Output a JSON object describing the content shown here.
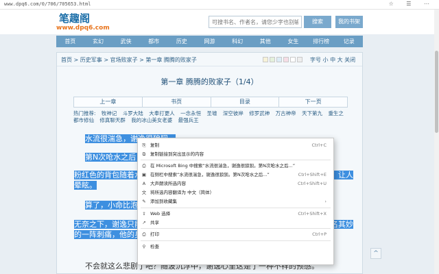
{
  "browser": {
    "url": "www.dpq6.com/0/706/705653.html",
    "actions": "☆ ☰ ⋯"
  },
  "site": {
    "logo_text": "笔趣阁",
    "domain": "www.dpq6.com",
    "search_placeholder": "可搜书名、作者名，请您少字也别输错字",
    "search_button": "搜索",
    "bookshelf_button": "我的书架"
  },
  "nav": [
    "首页",
    "玄幻",
    "武侠",
    "都市",
    "历史",
    "网游",
    "科幻",
    "其他",
    "女生",
    "排行榜",
    "记录"
  ],
  "breadcrumb": {
    "text": "首页 > 历史军事 > 官场败家子 > 第一章 腾腾的败家子",
    "swatch_colors": [
      "#f7f2d8",
      "#e4f1dc",
      "#dcecf6",
      "#f6dde6",
      "#ffffff",
      "#eeeeee"
    ],
    "font_controls": "字号 小 中 大 关闭"
  },
  "chapter": {
    "title": "第一章 腾腾的败家子（1/4）",
    "nav": [
      "上一章",
      "书页",
      "目录",
      "下一页"
    ]
  },
  "ads": [
    "热门推荐:",
    "牧神记",
    "斗罗大陆",
    "大奉打更人",
    "一念永恒",
    "圣墟",
    "深空彼岸",
    "修罗武神",
    "万古神帝",
    "天下第九",
    "重生之都市修仙",
    "修真聊天群",
    "我的冰山美女老婆",
    "最强兵王"
  ],
  "paragraphs": [
    {
      "text": "水流很湍急，谢逸很狼狈。"
    },
    {
      "text": "第N次呛水之后，他终于意识到"
    },
    {
      "text": "粉红色的背包随着水流飘走，让他知道自己没了活路，湍急的水再次灌入口鼻，让人晕眩。"
    },
    {
      "text": "算了，小命比泡妞要紧，"
    },
    {
      "text": "无奈之下，谢逸只能看着她离开，却想不出一个好的办法，关键时刻，脑袋莫名其妙的一阵刺痛，他的身体像是被人控制了一般，整个人便有些懵圈了。"
    },
    {
      "text": "不会就这么悲剧了吧？随波沉浮中，谢逸心里这是了一种不祥的预感。"
    }
  ],
  "context_menu": {
    "items": [
      {
        "icon": "⎘",
        "label": "复制",
        "shortcut": "Ctrl+C"
      },
      {
        "icon": "⧉",
        "label": "复制链接到突出显示的内容",
        "shortcut": ""
      },
      {
        "icon": "⎙",
        "label": "在 Microsoft Bing 中搜索“水流很湍急，谢逸很狼狈。第N次呛水之后...”",
        "shortcut": ""
      },
      {
        "icon": "▣",
        "label": "在侧栏中搜索“水流很湍急，谢逸很狼狈。第N次呛水之后...”",
        "shortcut": "Ctrl+Shift+E"
      },
      {
        "icon": "A",
        "label": "大声朗读所选内容",
        "shortcut": "Ctrl+Shift+U"
      },
      {
        "icon": "文",
        "label": "将所选内容翻译为 中文（简体）",
        "shortcut": ""
      },
      {
        "icon": "✎",
        "label": "添加到收藏集",
        "shortcut": ""
      },
      {
        "icon": "⇪",
        "label": "Web 选择",
        "shortcut": "Ctrl+Shift+X"
      },
      {
        "icon": "↗",
        "label": "共享",
        "shortcut": ""
      },
      {
        "icon": "⎙",
        "label": "打印",
        "shortcut": "Ctrl+P"
      },
      {
        "icon": "⚲",
        "label": "检查",
        "shortcut": ""
      }
    ]
  },
  "back_top": "^"
}
